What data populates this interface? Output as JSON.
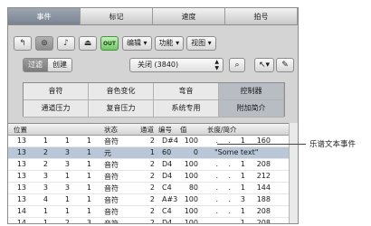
{
  "tabs": [
    "事件",
    "标记",
    "速度",
    "拍号"
  ],
  "toolbar": {
    "icon_buttons": [
      "t-up-icon",
      "link-icon",
      "midi-out-icon",
      "midi-in-icon"
    ],
    "green_label": "OUT",
    "menus": [
      "编辑",
      "功能",
      "视图"
    ]
  },
  "filter": {
    "segments": [
      "过滤",
      "创建"
    ],
    "select_value": "关闭 (3840)"
  },
  "event_types": [
    "音符",
    "音色变化",
    "弯音",
    "控制器",
    "通道压力",
    "复音压力",
    "系统专用",
    "附加简介"
  ],
  "table": {
    "headers": [
      "位置",
      "状态",
      "通道",
      "编号",
      "值",
      "长度/简介"
    ],
    "rows": [
      {
        "pos": [
          "13",
          "1",
          "1",
          "1"
        ],
        "status": "音符",
        "ch": "2",
        "num": "D#4",
        "val": "100",
        "len": [
          ".",
          ".",
          "1",
          "160"
        ]
      },
      {
        "pos": [
          "13",
          "2",
          "3",
          "1"
        ],
        "status": "元",
        "ch": "1",
        "num": "60",
        "val": "0",
        "text": "\"Some text\""
      },
      {
        "pos": [
          "13",
          "2",
          "3",
          "1"
        ],
        "status": "音符",
        "ch": "2",
        "num": "D4",
        "val": "100",
        "len": [
          ".",
          ".",
          "1",
          "208"
        ]
      },
      {
        "pos": [
          "13",
          "3",
          "1",
          "1"
        ],
        "status": "音符",
        "ch": "2",
        "num": "D4",
        "val": "100",
        "len": [
          ".",
          ".",
          "1",
          "212"
        ]
      },
      {
        "pos": [
          "13",
          "3",
          "3",
          "1"
        ],
        "status": "音符",
        "ch": "2",
        "num": "C4",
        "val": "80",
        "len": [
          ".",
          ".",
          "1",
          "144"
        ]
      },
      {
        "pos": [
          "13",
          "4",
          "1",
          "1"
        ],
        "status": "音符",
        "ch": "2",
        "num": "A#3",
        "val": "100",
        "len": [
          ".",
          ".",
          "3",
          "188"
        ]
      },
      {
        "pos": [
          "14",
          "1",
          "1",
          "1"
        ],
        "status": "音符",
        "ch": "2",
        "num": "C4",
        "val": "100",
        "len": [
          ".",
          ".",
          "1",
          "208"
        ]
      },
      {
        "pos": [
          "14",
          "1",
          "2",
          "3"
        ],
        "status": "音符",
        "ch": "2",
        "num": "D4",
        "val": "100",
        "len": [
          ".",
          ".",
          "1",
          "208"
        ]
      }
    ]
  },
  "callout": "乐谱文本事件"
}
